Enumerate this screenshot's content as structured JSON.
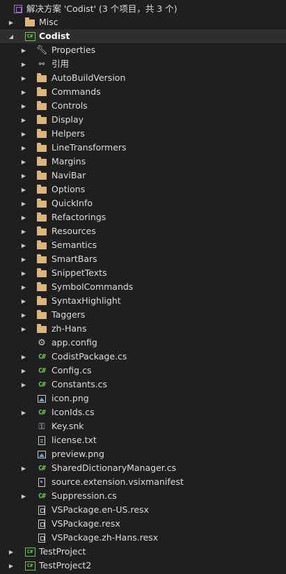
{
  "solution": {
    "label": "解决方案 'Codist' (3 个项目，共 3 个)"
  },
  "items": [
    {
      "label": "Misc",
      "icon": "folder-icon",
      "arrow": "collapsed"
    },
    {
      "label": "Codist",
      "icon": "csharp-project-icon",
      "arrow": "expanded"
    },
    {
      "label": "Properties",
      "icon": "wrench-icon",
      "arrow": "collapsed"
    },
    {
      "label": "引用",
      "icon": "references-icon",
      "arrow": "collapsed"
    },
    {
      "label": "AutoBuildVersion",
      "icon": "folder-icon",
      "arrow": "collapsed"
    },
    {
      "label": "Commands",
      "icon": "folder-icon",
      "arrow": "collapsed"
    },
    {
      "label": "Controls",
      "icon": "folder-icon",
      "arrow": "collapsed"
    },
    {
      "label": "Display",
      "icon": "folder-icon",
      "arrow": "collapsed"
    },
    {
      "label": "Helpers",
      "icon": "folder-icon",
      "arrow": "collapsed"
    },
    {
      "label": "LineTransformers",
      "icon": "folder-icon",
      "arrow": "collapsed"
    },
    {
      "label": "Margins",
      "icon": "folder-icon",
      "arrow": "collapsed"
    },
    {
      "label": "NaviBar",
      "icon": "folder-icon",
      "arrow": "collapsed"
    },
    {
      "label": "Options",
      "icon": "folder-icon",
      "arrow": "collapsed"
    },
    {
      "label": "QuickInfo",
      "icon": "folder-icon",
      "arrow": "collapsed"
    },
    {
      "label": "Refactorings",
      "icon": "folder-icon",
      "arrow": "collapsed"
    },
    {
      "label": "Resources",
      "icon": "folder-icon",
      "arrow": "collapsed"
    },
    {
      "label": "Semantics",
      "icon": "folder-icon",
      "arrow": "collapsed"
    },
    {
      "label": "SmartBars",
      "icon": "folder-icon",
      "arrow": "collapsed"
    },
    {
      "label": "SnippetTexts",
      "icon": "folder-icon",
      "arrow": "collapsed"
    },
    {
      "label": "SymbolCommands",
      "icon": "folder-icon",
      "arrow": "collapsed"
    },
    {
      "label": "SyntaxHighlight",
      "icon": "folder-icon",
      "arrow": "collapsed"
    },
    {
      "label": "Taggers",
      "icon": "folder-icon",
      "arrow": "collapsed"
    },
    {
      "label": "zh-Hans",
      "icon": "folder-icon",
      "arrow": "collapsed"
    },
    {
      "label": "app.config",
      "icon": "config-icon",
      "arrow": "none"
    },
    {
      "label": "CodistPackage.cs",
      "icon": "csharp-file-icon",
      "arrow": "collapsed"
    },
    {
      "label": "Config.cs",
      "icon": "csharp-file-icon",
      "arrow": "collapsed"
    },
    {
      "label": "Constants.cs",
      "icon": "csharp-file-icon",
      "arrow": "collapsed"
    },
    {
      "label": "icon.png",
      "icon": "image-icon",
      "arrow": "none"
    },
    {
      "label": "IconIds.cs",
      "icon": "csharp-file-icon",
      "arrow": "collapsed"
    },
    {
      "label": "Key.snk",
      "icon": "key-icon",
      "arrow": "none"
    },
    {
      "label": "license.txt",
      "icon": "text-file-icon",
      "arrow": "none"
    },
    {
      "label": "preview.png",
      "icon": "image-icon",
      "arrow": "none"
    },
    {
      "label": "SharedDictionaryManager.cs",
      "icon": "csharp-file-icon",
      "arrow": "collapsed"
    },
    {
      "label": "source.extension.vsixmanifest",
      "icon": "manifest-icon",
      "arrow": "none"
    },
    {
      "label": "Suppression.cs",
      "icon": "csharp-file-icon",
      "arrow": "collapsed"
    },
    {
      "label": "VSPackage.en-US.resx",
      "icon": "resx-icon",
      "arrow": "none"
    },
    {
      "label": "VSPackage.resx",
      "icon": "resx-icon",
      "arrow": "none"
    },
    {
      "label": "VSPackage.zh-Hans.resx",
      "icon": "resx-icon",
      "arrow": "none"
    },
    {
      "label": "TestProject",
      "icon": "csharp-project-icon",
      "arrow": "collapsed"
    },
    {
      "label": "TestProject2",
      "icon": "csharp-project-icon",
      "arrow": "collapsed"
    }
  ],
  "colors": {
    "background": "#1f1f1f",
    "text": "#dcdcdc",
    "folder": "#dcb67a",
    "csharp": "#6cc644",
    "solution": "#9b6fd1",
    "selection": "#2e2e2e"
  }
}
